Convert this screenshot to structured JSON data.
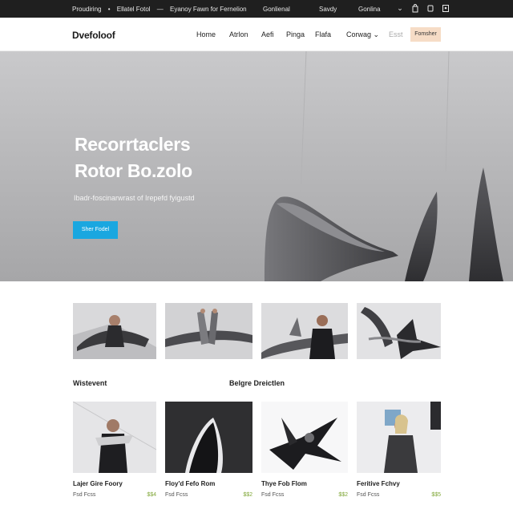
{
  "topbar": {
    "left_items": [
      "Proudiring",
      "Ellatel Fotol",
      "Eyanoy Fawn for Fernelion"
    ],
    "right_items": [
      "Gonlienal",
      "Savdy",
      "Gonlina"
    ],
    "icons": [
      "chevron-down-icon",
      "bag-icon",
      "cart-icon",
      "account-icon"
    ]
  },
  "nav": {
    "logo": "Dvefoloof",
    "items": [
      "Home",
      "Atrlon",
      "Aefi",
      "Pinga",
      "Flafa",
      "Corwag"
    ],
    "muted_item": "Esst",
    "cta": "Fomsher"
  },
  "hero": {
    "title_line1": "Recorrtaclers",
    "title_line2": "Rotor Bo.zolo",
    "subtitle": "Ibadr-foscinarwrast of Irepefd fyigustd",
    "button": "Sher Fodel"
  },
  "sections": {
    "left_label": "Wistevent",
    "right_label": "Belgre Dreictlen"
  },
  "products": [
    {
      "name": "Lajer Gire Foory",
      "meta": "Fsd Fcss",
      "price": "$$4"
    },
    {
      "name": "Floy'd Fefo Rom",
      "meta": "Fsd Fcss",
      "price": "$$2"
    },
    {
      "name": "Thye Fob Flom",
      "meta": "Fsd Fcss",
      "price": "$$2"
    },
    {
      "name": "Feritive Fchvy",
      "meta": "Fsd Fcss",
      "price": "$$5"
    }
  ],
  "colors": {
    "topbar_bg": "#1f1f1f",
    "accent_button": "#1aa7e0",
    "cta_bg": "#f6dcc6",
    "price": "#7fa636"
  }
}
